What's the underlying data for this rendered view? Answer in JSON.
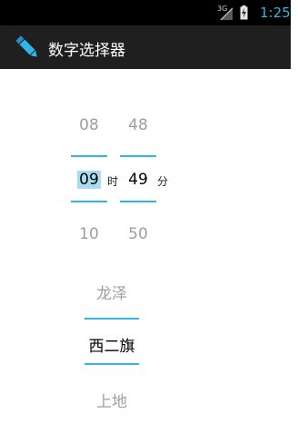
{
  "status_bar": {
    "network": "3G",
    "time": "1:25"
  },
  "app": {
    "title": "数字选择器",
    "icon": "pencil-icon",
    "accent": "#33b5e5",
    "bar_color": "#1f1f1f"
  },
  "time_picker": {
    "hour": {
      "prev": "08",
      "current": "09",
      "next": "10"
    },
    "hour_unit": "时",
    "minute": {
      "prev": "48",
      "current": "49",
      "next": "50"
    },
    "minute_unit": "分"
  },
  "location_picker": {
    "prev": "龙泽",
    "current": "西二旗",
    "next": "上地"
  }
}
